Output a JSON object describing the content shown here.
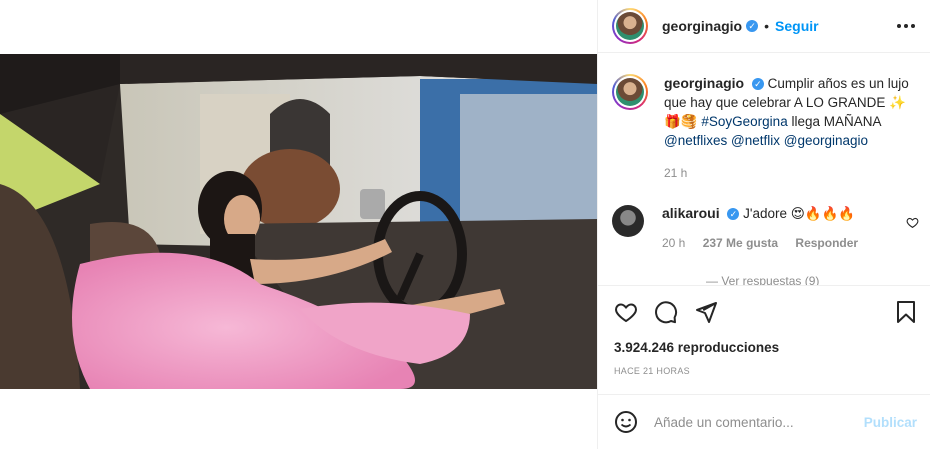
{
  "post": {
    "username": "georginagio",
    "follow_label": "Seguir",
    "separator": "•",
    "caption": {
      "username": "georginagio",
      "text_part1": "Cumplir años es un lujo que hay que celebrar A LO GRANDE ✨ 🎁🥞",
      "hashtag": "#SoyGeorgina",
      "text_part2": "llega MAÑANA",
      "mention1": "@netflixes",
      "mention2": "@netflix",
      "mention3": "@georginagio",
      "time": "21 h"
    },
    "comment": {
      "username": "alikaroui",
      "text": "J'adore 😍🔥🔥🔥",
      "time": "20 h",
      "likes": "237 Me gusta",
      "reply_label": "Responder",
      "view_replies": "— Ver respuestas (9)"
    },
    "views": "3.924.246 reproducciones",
    "time_ago": "HACE 21 HORAS",
    "add_comment_placeholder": "Añade un comentario...",
    "publish_label": "Publicar"
  },
  "colors": {
    "link": "#00376b",
    "accent": "#0095f6",
    "verified": "#3897f0",
    "publish_disabled": "#b2dffc"
  },
  "icons": [
    "more-options-icon",
    "verified-badge-icon",
    "heart-icon",
    "comment-icon",
    "share-icon",
    "bookmark-icon",
    "emoji-icon",
    "heart-small-icon"
  ]
}
